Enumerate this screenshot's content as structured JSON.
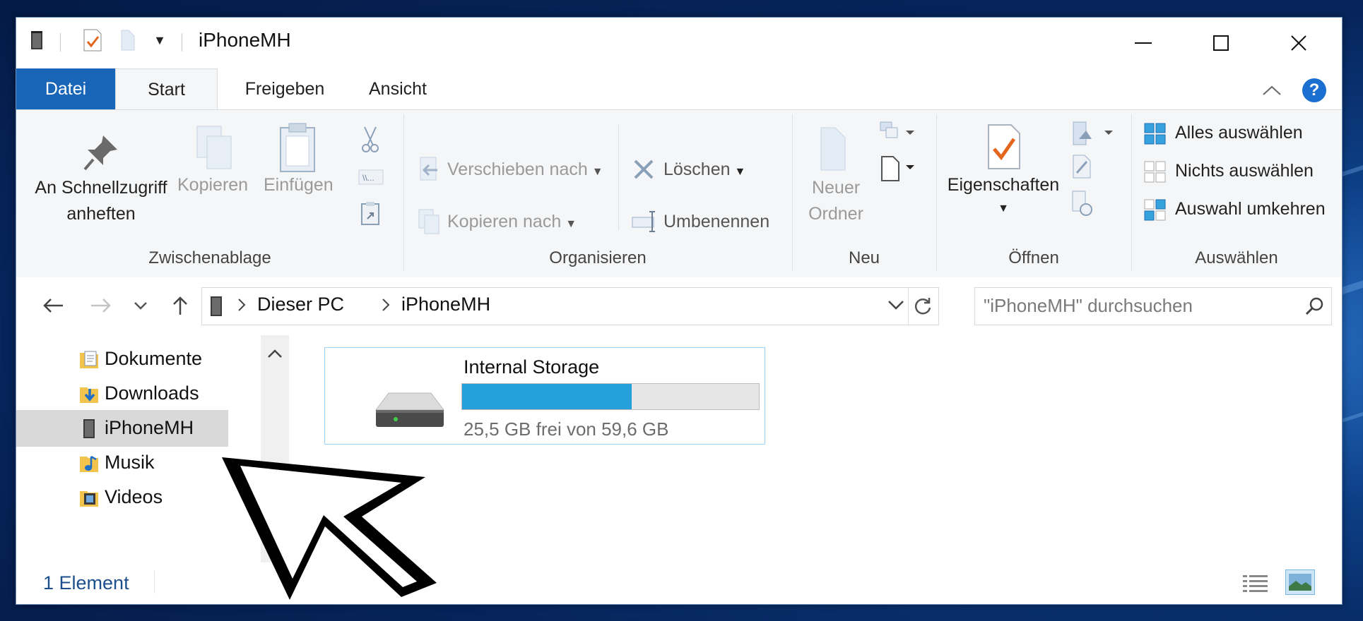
{
  "window": {
    "title": "iPhoneMH"
  },
  "tabs": {
    "file": "Datei",
    "start": "Start",
    "share": "Freigeben",
    "view": "Ansicht"
  },
  "ribbon": {
    "clipboard": {
      "pin_line1": "An Schnellzugriff",
      "pin_line2": "anheften",
      "copy": "Kopieren",
      "paste": "Einfügen",
      "label": "Zwischenablage"
    },
    "organize": {
      "move_to": "Verschieben nach",
      "copy_to": "Kopieren nach",
      "delete": "Löschen",
      "rename": "Umbenennen",
      "label": "Organisieren"
    },
    "new": {
      "new_folder_line1": "Neuer",
      "new_folder_line2": "Ordner",
      "label": "Neu"
    },
    "open": {
      "properties": "Eigenschaften",
      "label": "Öffnen"
    },
    "select": {
      "select_all": "Alles auswählen",
      "select_none": "Nichts auswählen",
      "invert": "Auswahl umkehren",
      "label": "Auswählen"
    }
  },
  "address": {
    "crumbs": [
      "Dieser PC",
      "iPhoneMH"
    ],
    "search_placeholder": "\"iPhoneMH\" durchsuchen"
  },
  "navpane": {
    "items": [
      {
        "label": "Dokumente",
        "icon": "documents-folder-icon"
      },
      {
        "label": "Downloads",
        "icon": "downloads-folder-icon"
      },
      {
        "label": "iPhoneMH",
        "icon": "device-icon",
        "selected": true
      },
      {
        "label": "Musik",
        "icon": "music-folder-icon"
      },
      {
        "label": "Videos",
        "icon": "videos-folder-icon"
      }
    ]
  },
  "content": {
    "drive": {
      "name": "Internal Storage",
      "free_text": "25,5 GB frei von 59,6 GB",
      "used_fraction": 0.572
    }
  },
  "status": {
    "count": "1 Element"
  },
  "colors": {
    "accent": "#1965b8",
    "progress": "#26a0da",
    "help": "#1a6fd0"
  }
}
